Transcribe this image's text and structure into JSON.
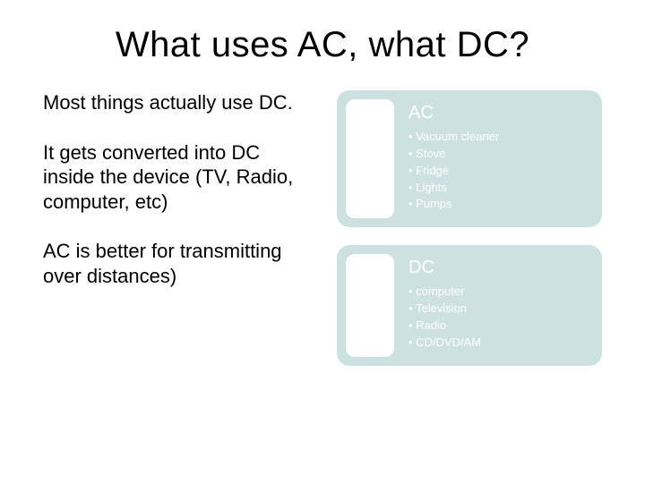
{
  "title": "What uses AC, what DC?",
  "left": {
    "p1": "Most things actually use DC.",
    "p2": "It gets converted into DC inside the device (TV, Radio, computer, etc)",
    "p3": "AC is better for transmitting over distances)"
  },
  "ac": {
    "title": "AC",
    "items": [
      "Vacuum cleaner",
      "Stove",
      "Fridge",
      "Lights",
      "Pumps"
    ]
  },
  "dc": {
    "title": "DC",
    "items": [
      "computer",
      "Television",
      "Radio",
      "CD/DVD/AM"
    ]
  }
}
